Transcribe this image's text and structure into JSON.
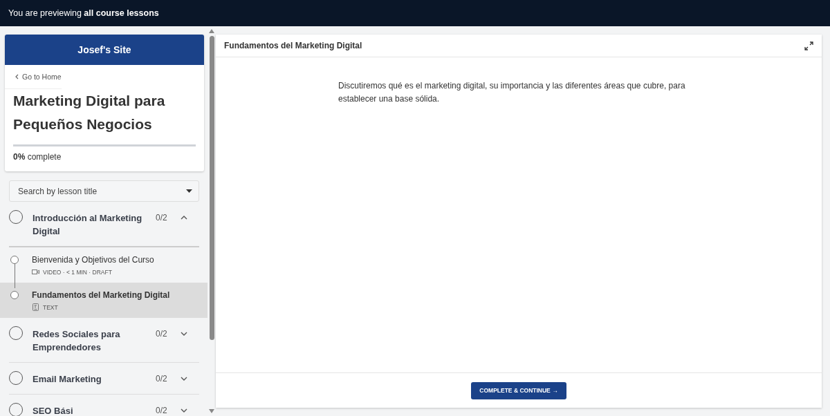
{
  "banner": {
    "text": "You are previewing **all course lessons**"
  },
  "sidebar": {
    "site_name": "Josef's Site",
    "back_link": "Go to Home",
    "course_title": "Marketing Digital para Pequeños Negocios",
    "progress": {
      "level": 0,
      "label": "**0%** complete"
    },
    "search": {
      "placeholder": "Search by lesson title"
    },
    "chapters": [
      {
        "title": "Introducción al Marketing Digital",
        "count": "0/2",
        "expanded": true,
        "lessons": [
          {
            "title": "Bienvenida y Objetivos del Curso",
            "kind": "video",
            "meta": "VIDEO · < 1 MIN ·  DRAFT",
            "selected": false
          },
          {
            "title": "Fundamentos del Marketing Digital",
            "kind": "text",
            "meta": "TEXT",
            "selected": true
          }
        ]
      },
      {
        "title": "Redes Sociales para Emprendedores",
        "count": "0/2",
        "expanded": false
      },
      {
        "title": "Email Marketing",
        "count": "0/2",
        "expanded": false
      },
      {
        "title": "SEO Bási",
        "count": "0/2",
        "expanded": false
      }
    ]
  },
  "lesson": {
    "title": "Fundamentos del Marketing Digital",
    "body": "Discutiremos qué es el marketing digital, su importancia y las diferentes áreas que cubre, para establecer una base sólida.",
    "button": "COMPLETE & CONTINUE",
    "button_arrow": "→"
  }
}
